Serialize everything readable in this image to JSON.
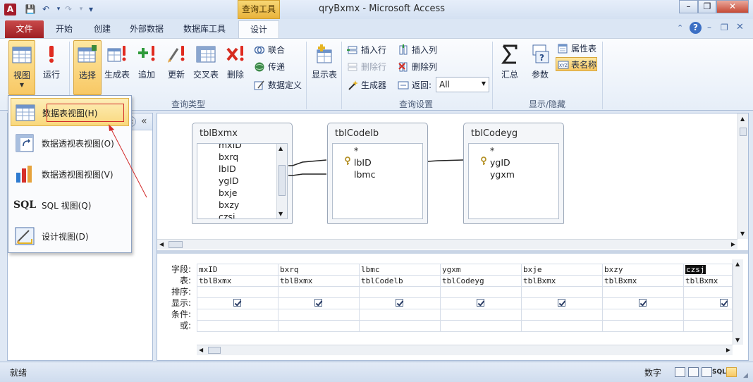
{
  "quick_access": {
    "app_icon": "A",
    "save_icon": "💾",
    "undo_icon": "↶",
    "redo_icon": "↷",
    "customize_icon": "▾"
  },
  "window": {
    "title": "qryBxmx - Microsoft Access",
    "context_tab_group": "查询工具",
    "minimize": "–",
    "restore": "❐",
    "close": "✕"
  },
  "tabs": {
    "file": "文件",
    "home": "开始",
    "create": "创建",
    "external": "外部数据",
    "dbtools": "数据库工具",
    "design": "设计"
  },
  "ribbon": {
    "view": "视图",
    "run": "运行",
    "select": "选择",
    "make_table": "生成表",
    "append": "追加",
    "update": "更新",
    "crosstab": "交叉表",
    "delete": "删除",
    "union": "联合",
    "pass_through": "传递",
    "data_definition": "数据定义",
    "show_table": "显示表",
    "insert_rows": "插入行",
    "delete_rows": "删除行",
    "builder": "生成器",
    "insert_columns": "插入列",
    "delete_columns": "删除列",
    "return_label": "返回:",
    "return_value": "All",
    "totals": "汇总",
    "parameters": "参数",
    "property_sheet": "属性表",
    "table_names": "表名称",
    "group_query_type": "查询类型",
    "group_query_setup": "查询设置",
    "group_show_hide": "显示/隐藏"
  },
  "view_menu": {
    "items": [
      {
        "label": "数据表视图(H)"
      },
      {
        "label": "数据透视表视图(O)"
      },
      {
        "label": "数据透视图视图(V)"
      },
      {
        "label": "SQL 视图(Q)",
        "icon_text": "SQL"
      },
      {
        "label": "设计视图(D)"
      }
    ]
  },
  "nav": {
    "close_icon": "×",
    "collapse_icon": "«"
  },
  "tables": [
    {
      "name": "tblBxmx",
      "fields": [
        "mxID",
        "bxrq",
        "lbID",
        "ygID",
        "bxje",
        "bxzy",
        "czsj"
      ]
    },
    {
      "name": "tblCodelb",
      "fields": [
        "*",
        "lbID",
        "lbmc"
      ]
    },
    {
      "name": "tblCodeyg",
      "fields": [
        "*",
        "ygID",
        "ygxm"
      ]
    }
  ],
  "qbe": {
    "row_labels": [
      "字段:",
      "表:",
      "排序:",
      "显示:",
      "条件:",
      "或:"
    ],
    "columns": [
      {
        "field": "mxID",
        "table": "tblBxmx"
      },
      {
        "field": "bxrq",
        "table": "tblBxmx"
      },
      {
        "field": "lbmc",
        "table": "tblCodelb"
      },
      {
        "field": "ygxm",
        "table": "tblCodeyg"
      },
      {
        "field": "bxje",
        "table": "tblBxmx"
      },
      {
        "field": "bxzy",
        "table": "tblBxmx"
      },
      {
        "field": "czsj",
        "table": "tblBxmx"
      }
    ]
  },
  "status": {
    "text": "就绪",
    "mode": "数字",
    "sql_icon": "SQL"
  }
}
